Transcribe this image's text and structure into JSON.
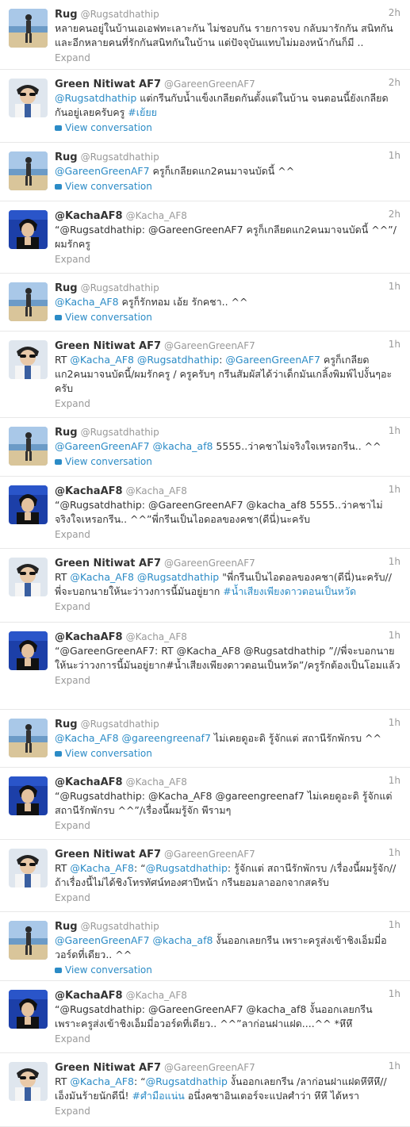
{
  "labels": {
    "expand": "Expand",
    "view_conversation": "View conversation"
  },
  "colors": {
    "link": "#2b8bc6",
    "muted": "#999999",
    "text": "#333333"
  },
  "tweets": [
    {
      "avatar": "rug",
      "name": "Rug",
      "handle": "@Rugsatdhathip",
      "time": "2h",
      "segments": [
        {
          "t": "หลายคนอยู่ในบ้านเอเอฟทะเลาะกัน ไม่ชอบกัน รายการจบ กลับมารักกัน สนิทกัน และอีกหลายคนที่รักกันสนิทกันในบ้าน แต่ปัจจุบันแทบไม่มองหน้ากันก็มี ..",
          "l": false
        }
      ],
      "action": "expand"
    },
    {
      "avatar": "green",
      "name": "Green Nitiwat AF7",
      "handle": "@GareenGreenAF7",
      "time": "2h",
      "segments": [
        {
          "t": "@Rugsatdhathip",
          "l": true
        },
        {
          "t": " แต่กรีนกับน้ำแข็งเกลียดกันตั้งแต่ในบ้าน จนตอนนี้ยังเกลียดกันอยู่เลยครับครู ",
          "l": false
        },
        {
          "t": "#เย้ยย",
          "l": true
        }
      ],
      "action": "conversation"
    },
    {
      "avatar": "rug",
      "name": "Rug",
      "handle": "@Rugsatdhathip",
      "time": "1h",
      "segments": [
        {
          "t": "@GareenGreenAF7",
          "l": true
        },
        {
          "t": " ครูก็เกลียดแก2คนมาจนบัดนี้ ^^",
          "l": false
        }
      ],
      "action": "conversation"
    },
    {
      "avatar": "kacha",
      "name": "@KachaAF8",
      "handle": "@Kacha_AF8",
      "time": "2h",
      "segments": [
        {
          "t": "“@Rugsatdhathip: @GareenGreenAF7 ครูก็เกลียดแก2คนมาจนบัดนี้ ^^”/ผมรักครู",
          "l": false
        }
      ],
      "action": "expand"
    },
    {
      "avatar": "rug",
      "name": "Rug",
      "handle": "@Rugsatdhathip",
      "time": "1h",
      "segments": [
        {
          "t": "@Kacha_AF8",
          "l": true
        },
        {
          "t": " ครูก็รักทอม เอ้ย รักคชา.. ^^",
          "l": false
        }
      ],
      "action": "conversation"
    },
    {
      "avatar": "green",
      "name": "Green Nitiwat AF7",
      "handle": "@GareenGreenAF7",
      "time": "1h",
      "segments": [
        {
          "t": "RT ",
          "l": false
        },
        {
          "t": "@Kacha_AF8",
          "l": true
        },
        {
          "t": " ",
          "l": false
        },
        {
          "t": "@Rugsatdhathip",
          "l": true
        },
        {
          "t": ": ",
          "l": false
        },
        {
          "t": "@GareenGreenAF7",
          "l": true
        },
        {
          "t": " ครูก็เกลียดแก2คนมาจนบัดนี้/ผมรักครู / ครูครับๆ กรีนสัมผัสได้ว่าเด็กมันเกลิ้งพิมพ์ไปงั้นๆอะครับ",
          "l": false
        }
      ],
      "action": "expand"
    },
    {
      "avatar": "rug",
      "name": "Rug",
      "handle": "@Rugsatdhathip",
      "time": "1h",
      "segments": [
        {
          "t": "@GareenGreenAF7",
          "l": true
        },
        {
          "t": " ",
          "l": false
        },
        {
          "t": "@kacha_af8",
          "l": true
        },
        {
          "t": " 5555..ว่าคชาไม่จริงใจเหรอกรีน.. ^^",
          "l": false
        }
      ],
      "action": "conversation"
    },
    {
      "avatar": "kacha",
      "name": "@KachaAF8",
      "handle": "@Kacha_AF8",
      "time": "1h",
      "segments": [
        {
          "t": "“@Rugsatdhathip: @GareenGreenAF7 @kacha_af8 5555..ว่าคชาไม่จริงใจเหรอกรีน.. ^^”พี่กรีนเป็นไอดอลของคชา(ดีนี่)นะครับ",
          "l": false
        }
      ],
      "action": "expand"
    },
    {
      "avatar": "green",
      "name": "Green Nitiwat AF7",
      "handle": "@GareenGreenAF7",
      "time": "1h",
      "segments": [
        {
          "t": "RT ",
          "l": false
        },
        {
          "t": "@Kacha_AF8",
          "l": true
        },
        {
          "t": " ",
          "l": false
        },
        {
          "t": "@Rugsatdhathip",
          "l": true
        },
        {
          "t": " \"พี่กรีนเป็นไอดอลของคชา(ดีนี่)นะครับ// พี่จะบอกนายให้นะว่าวงการนี้มันอยู่ยาก ",
          "l": false
        },
        {
          "t": "#น้ำเสียงเพียงดาวตอนเป็นหวัด",
          "l": true
        }
      ],
      "action": "expand"
    },
    {
      "avatar": "kacha",
      "name": "@KachaAF8",
      "handle": "@Kacha_AF8",
      "time": "1h",
      "segments": [
        {
          "t": "“@GareenGreenAF7: RT @Kacha_AF8 @Rugsatdhathip ”//พี่จะบอกนายให้นะว่าวงการนี้มันอยู่ยาก#น้ำเสียงเพียงดาวตอนเป็นหวัด”/ครูรักต้องเป็นโอมแล้ว",
          "l": false
        }
      ],
      "action": "expand"
    },
    {
      "avatar": "rug",
      "name": "Rug",
      "handle": "@Rugsatdhathip",
      "time": "1h",
      "segments": [
        {
          "t": "@Kacha_AF8",
          "l": true
        },
        {
          "t": " ",
          "l": false
        },
        {
          "t": "@gareengreenaf7",
          "l": true
        },
        {
          "t": " ไม่เคยดูอะดิ รู้จักแต่ สถานีรักพักรบ ^^",
          "l": false
        }
      ],
      "action": "conversation"
    },
    {
      "avatar": "kacha",
      "name": "@KachaAF8",
      "handle": "@Kacha_AF8",
      "time": "1h",
      "segments": [
        {
          "t": "“@Rugsatdhathip: @Kacha_AF8 @gareengreenaf7 ไม่เคยดูอะดิ รู้จักแต่ สถานีรักพักรบ ^^”/เรื่องนี้ผมรู้จัก พีรามๆ",
          "l": false
        }
      ],
      "action": "expand"
    },
    {
      "avatar": "green",
      "name": "Green Nitiwat AF7",
      "handle": "@GareenGreenAF7",
      "time": "1h",
      "segments": [
        {
          "t": "RT ",
          "l": false
        },
        {
          "t": "@Kacha_AF8",
          "l": true
        },
        {
          "t": ": “",
          "l": false
        },
        {
          "t": "@Rugsatdhathip",
          "l": true
        },
        {
          "t": ": รู้จักแต่ สถานีรักพักรบ /เรื่องนี้ผมรู้จัก// ถ้าเรื่องนี้ไม่ได้ชิงโทรทัศน์ทองศาปีหน้า กรีนยอมลาออกจากสครับ",
          "l": false
        }
      ],
      "action": "expand"
    },
    {
      "avatar": "rug",
      "name": "Rug",
      "handle": "@Rugsatdhathip",
      "time": "1h",
      "segments": [
        {
          "t": "@GareenGreenAF7",
          "l": true
        },
        {
          "t": " ",
          "l": false
        },
        {
          "t": "@kacha_af8",
          "l": true
        },
        {
          "t": " งั้นออกเลยกรีน เพราะครูส่งเข้าชิงเอ็มมี่อวอร์ดที่เดียว.. ^^",
          "l": false
        }
      ],
      "action": "conversation"
    },
    {
      "avatar": "kacha",
      "name": "@KachaAF8",
      "handle": "@Kacha_AF8",
      "time": "1h",
      "segments": [
        {
          "t": "“@Rugsatdhathip: @GareenGreenAF7 @kacha_af8 งั้นออกเลยกรีน เพราะครูส่งเข้าชิงเอ็มมี่อวอร์ดที่เดียว.. ^^”ลาก่อนฝาแฝด....^^ *หึหึ",
          "l": false
        }
      ],
      "action": "expand"
    },
    {
      "avatar": "green",
      "name": "Green Nitiwat AF7",
      "handle": "@GareenGreenAF7",
      "time": "1h",
      "segments": [
        {
          "t": "RT ",
          "l": false
        },
        {
          "t": "@Kacha_AF8",
          "l": true
        },
        {
          "t": ": “",
          "l": false
        },
        {
          "t": "@Rugsatdhathip",
          "l": true
        },
        {
          "t": " งั้นออกเลยกรีน /ลาก่อนฝาแฝดหึหึหึ// เอ็งมันร้ายนักดีนี่! ",
          "l": false
        },
        {
          "t": "#ศำมือแน่น",
          "l": true
        },
        {
          "t": " อนึ่งคชาอินเตอร์จะแปลศำว่า หึหึ ได้หรา",
          "l": false
        }
      ],
      "action": "expand"
    }
  ]
}
